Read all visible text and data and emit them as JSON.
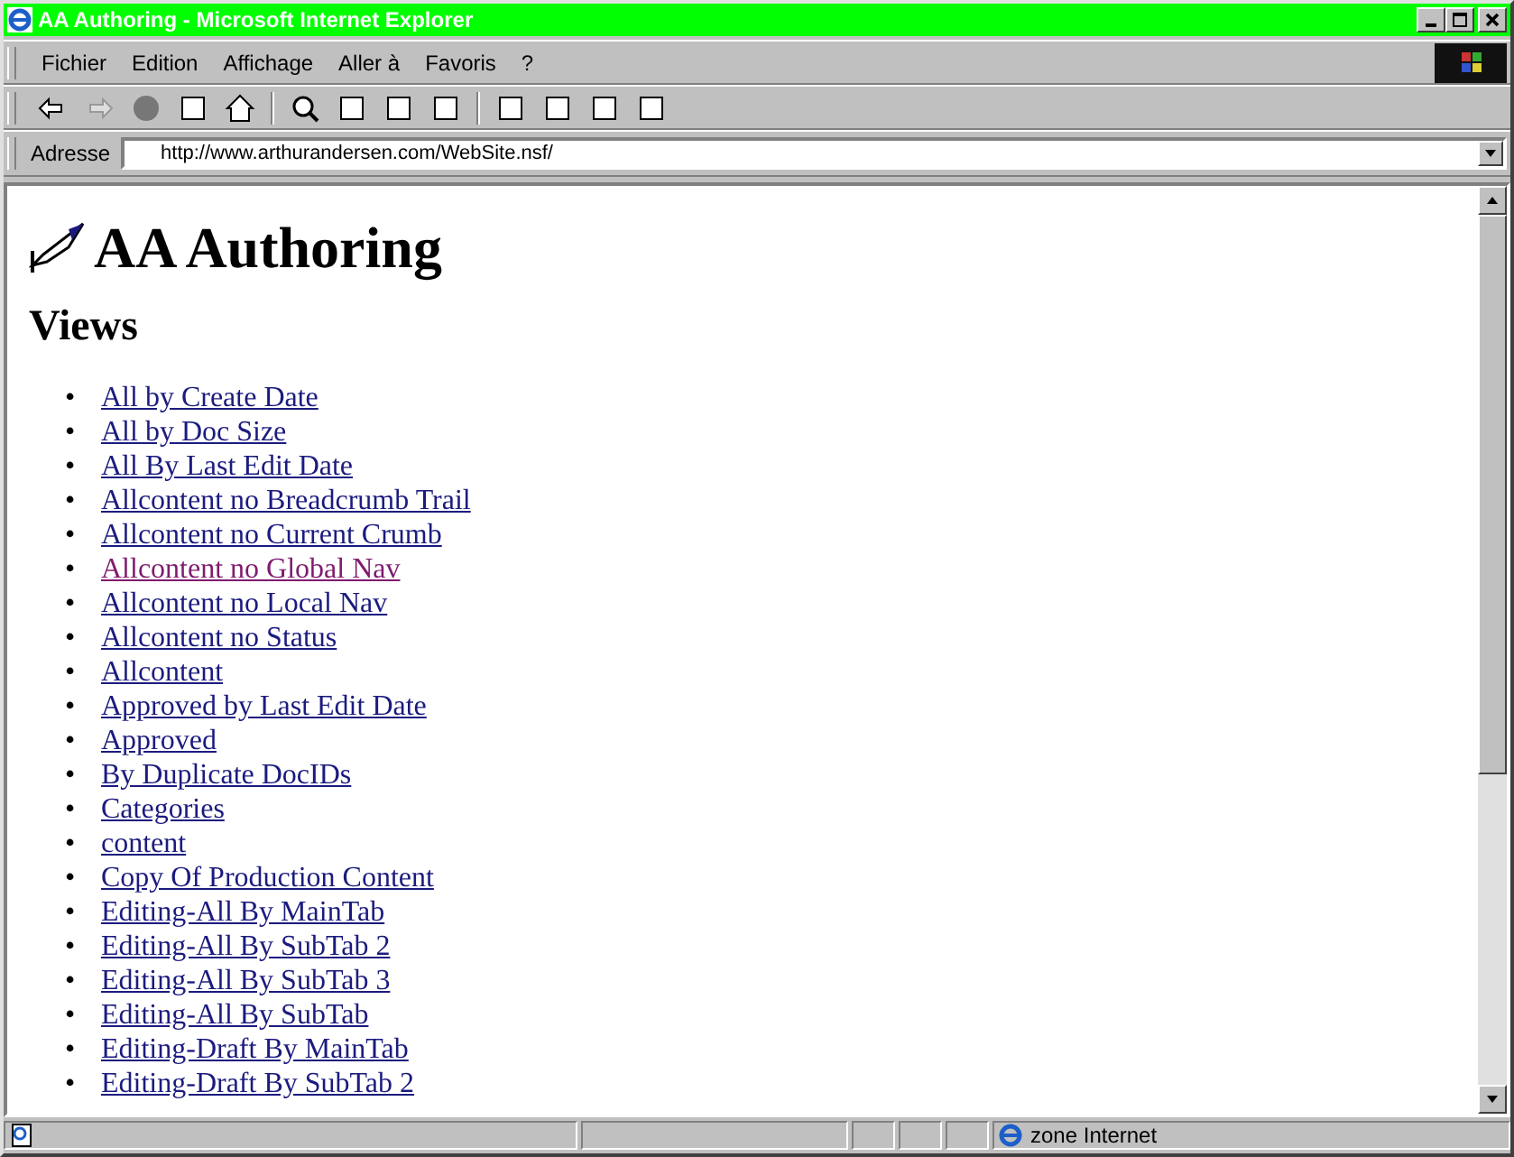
{
  "window": {
    "title": "AA Authoring - Microsoft Internet Explorer"
  },
  "menu": [
    "Fichier",
    "Edition",
    "Affichage",
    "Aller à",
    "Favoris",
    "?"
  ],
  "address": {
    "label": "Adresse",
    "value": "http://www.arthurandersen.com/WebSite.nsf/"
  },
  "page": {
    "title": "AA Authoring",
    "heading": "Views",
    "links": [
      {
        "bullet": "•",
        "text": "All by Create Date",
        "visited": false
      },
      {
        "bullet": "•",
        "text": "All by Doc Size",
        "visited": false
      },
      {
        "bullet": "•",
        "text": "All By Last Edit Date",
        "visited": false
      },
      {
        "bullet": "•",
        "text": "Allcontent no Breadcrumb Trail",
        "visited": false
      },
      {
        "bullet": "•",
        "text": "Allcontent no Current Crumb",
        "visited": false
      },
      {
        "bullet": "•",
        "text": "Allcontent no Global Nav",
        "visited": true
      },
      {
        "bullet": "•",
        "text": "Allcontent no Local Nav",
        "visited": false
      },
      {
        "bullet": "•",
        "text": "Allcontent no Status",
        "visited": false
      },
      {
        "bullet": "•",
        "text": "Allcontent",
        "visited": false
      },
      {
        "bullet": "•",
        "text": "Approved by Last Edit Date",
        "visited": false
      },
      {
        "bullet": "•",
        "text": "Approved",
        "visited": false
      },
      {
        "bullet": "•",
        "text": "By Duplicate DocIDs",
        "visited": false
      },
      {
        "bullet": "•",
        "text": "Categories",
        "visited": false
      },
      {
        "bullet": "•",
        "text": "content",
        "visited": false
      },
      {
        "bullet": "•",
        "text": "Copy Of Production Content",
        "visited": false
      },
      {
        "bullet": "•",
        "text": "Editing-All By MainTab",
        "visited": false
      },
      {
        "bullet": "•",
        "text": "Editing-All By SubTab 2",
        "visited": false
      },
      {
        "bullet": "•",
        "text": "Editing-All By SubTab 3",
        "visited": false
      },
      {
        "bullet": "•",
        "text": "Editing-All By SubTab",
        "visited": false
      },
      {
        "bullet": "•",
        "text": "Editing-Draft By MainTab",
        "visited": false
      },
      {
        "bullet": "•",
        "text": "Editing-Draft By SubTab 2",
        "visited": false
      }
    ]
  },
  "status_bar": {
    "zone": "zone Internet"
  }
}
